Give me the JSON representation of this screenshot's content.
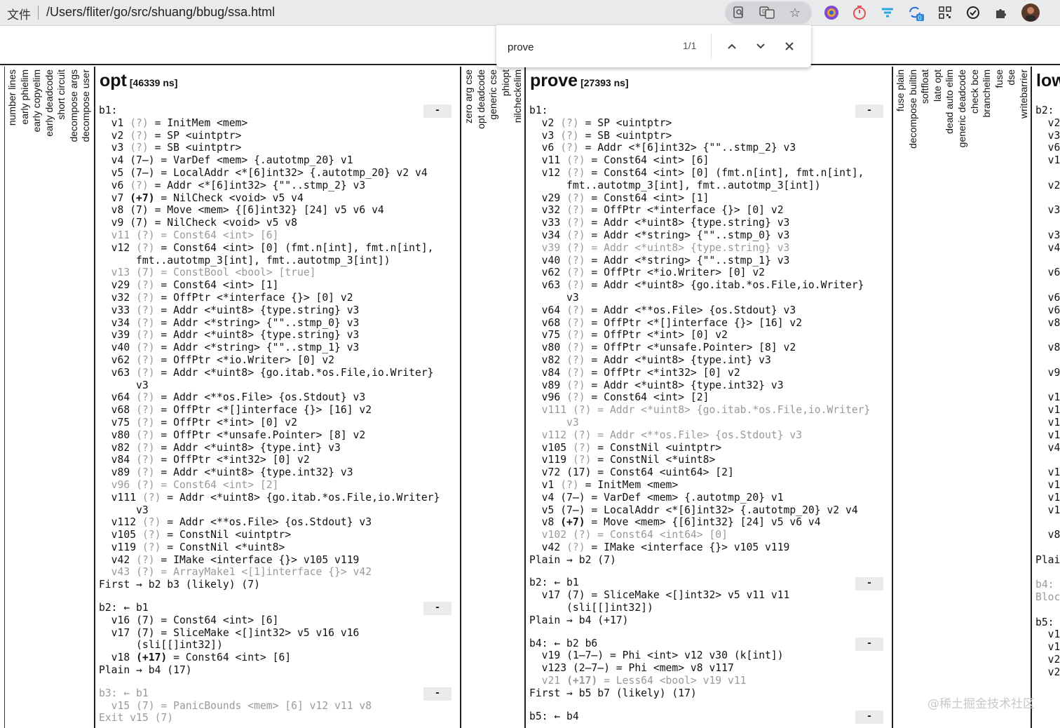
{
  "browser": {
    "page_kind": "文件",
    "url": "/Users/fliter/go/src/shuang/bbug/ssa.html",
    "icons": [
      "page-search-icon",
      "translate-icon",
      "bookmark-star-icon",
      "chrome-extension-icon",
      "timer-extension-icon",
      "filter-extension-icon",
      "sync-extension-icon",
      "qr-code-icon",
      "circle-check-extension-icon",
      "extensions-puzzle-icon",
      "profile-avatar"
    ],
    "sync_badge": "0"
  },
  "find": {
    "query": "prove",
    "count": "1/1"
  },
  "passes_left": [
    "number lines",
    "early phielim",
    "early copyelim",
    "early deadcode",
    "short circuit",
    "decompose args",
    "decompose user"
  ],
  "passes_mid": [
    "zero arg cse",
    "opt deadcode",
    "generic cse",
    "phiopt",
    "nilcheckelim"
  ],
  "passes_right": [
    "fuse plain",
    "decompose builtin",
    "softfloat",
    "late opt",
    "dead auto elim",
    "generic deadcode",
    "check bce",
    "branchelim",
    "fuse",
    "dse",
    "writebarrier"
  ],
  "collapse_label": "-",
  "watermark": "@稀土掘金技术社区",
  "opt": {
    "title": "opt",
    "time": "[46339 ns]",
    "blocks": [
      {
        "header": "b1:",
        "dead": false,
        "lines": [
          {
            "v": "v1",
            "n": "(?)",
            "t": "= InitMem <mem>"
          },
          {
            "v": "v2",
            "n": "(?)",
            "t": "= SP <uintptr>"
          },
          {
            "v": "v3",
            "n": "(?)",
            "t": "= SB <uintptr>"
          },
          {
            "v": "v4",
            "n": "(7̶)",
            "t": "= VarDef <mem> {.autotmp_20} v1"
          },
          {
            "v": "v5",
            "n": "(7̶)",
            "t": "= LocalAddr <*[6]int32> {.autotmp_20} v2 v4"
          },
          {
            "v": "v6",
            "n": "(?)",
            "t": "= Addr <*[6]int32> {\"\"..stmp_2} v3"
          },
          {
            "v": "v7",
            "n": "(+7)",
            "t": "= NilCheck <void> v5 v4"
          },
          {
            "v": "v8",
            "n": "(7)",
            "t": "= Move <mem> {[6]int32} [24] v5 v6 v4"
          },
          {
            "v": "v9",
            "n": "(7)",
            "t": "= NilCheck <void> v5 v8"
          },
          {
            "v": "v11",
            "n": "(?)",
            "t": "= Const64 <int> [6]",
            "dead": true
          },
          {
            "v": "v12",
            "n": "(?)",
            "t": "= Const64 <int> [0] (fmt.n[int], fmt.n[int],"
          },
          {
            "c": "    fmt..autotmp_3[int], fmt..autotmp_3[int])"
          },
          {
            "v": "v13",
            "n": "(7)",
            "t": "= ConstBool <bool> [true]",
            "dead": true
          },
          {
            "v": "v29",
            "n": "(?)",
            "t": "= Const64 <int> [1]"
          },
          {
            "v": "v32",
            "n": "(?)",
            "t": "= OffPtr <*interface {}> [0] v2"
          },
          {
            "v": "v33",
            "n": "(?)",
            "t": "= Addr <*uint8> {type.string} v3"
          },
          {
            "v": "v34",
            "n": "(?)",
            "t": "= Addr <*string> {\"\"..stmp_0} v3"
          },
          {
            "v": "v39",
            "n": "(?)",
            "t": "= Addr <*uint8> {type.string} v3"
          },
          {
            "v": "v40",
            "n": "(?)",
            "t": "= Addr <*string> {\"\"..stmp_1} v3"
          },
          {
            "v": "v62",
            "n": "(?)",
            "t": "= OffPtr <*io.Writer> [0] v2"
          },
          {
            "v": "v63",
            "n": "(?)",
            "t": "= Addr <*uint8> {go.itab.*os.File,io.Writer}"
          },
          {
            "c": "    v3"
          },
          {
            "v": "v64",
            "n": "(?)",
            "t": "= Addr <**os.File> {os.Stdout} v3"
          },
          {
            "v": "v68",
            "n": "(?)",
            "t": "= OffPtr <*[]interface {}> [16] v2"
          },
          {
            "v": "v75",
            "n": "(?)",
            "t": "= OffPtr <*int> [0] v2"
          },
          {
            "v": "v80",
            "n": "(?)",
            "t": "= OffPtr <*unsafe.Pointer> [8] v2"
          },
          {
            "v": "v82",
            "n": "(?)",
            "t": "= Addr <*uint8> {type.int} v3"
          },
          {
            "v": "v84",
            "n": "(?)",
            "t": "= OffPtr <*int32> [0] v2"
          },
          {
            "v": "v89",
            "n": "(?)",
            "t": "= Addr <*uint8> {type.int32} v3"
          },
          {
            "v": "v96",
            "n": "(?)",
            "t": "= Const64 <int> [2]",
            "dead": true
          },
          {
            "v": "v111",
            "n": "(?)",
            "t": "= Addr <*uint8> {go.itab.*os.File,io.Writer}"
          },
          {
            "c": "    v3"
          },
          {
            "v": "v112",
            "n": "(?)",
            "t": "= Addr <**os.File> {os.Stdout} v3"
          },
          {
            "v": "v105",
            "n": "(?)",
            "t": "= ConstNil <uintptr>"
          },
          {
            "v": "v119",
            "n": "(?)",
            "t": "= ConstNil <*uint8>"
          },
          {
            "v": "v42",
            "n": "(?)",
            "t": "= IMake <interface {}> v105 v119"
          },
          {
            "v": "v43",
            "n": "(?)",
            "t": "= ArrayMake1 <[1]interface {}> v42",
            "dead": true
          }
        ],
        "footer": "First → b2 b3 (likely) (7)"
      },
      {
        "header": "b2: ← b1",
        "dead": false,
        "lines": [
          {
            "v": "v16",
            "n": "(7)",
            "t": "= Const64 <int> [6]"
          },
          {
            "v": "v17",
            "n": "(7)",
            "t": "= SliceMake <[]int32> v5 v16 v16"
          },
          {
            "c": "    (sli[[]int32])"
          },
          {
            "v": "v18",
            "n": "(+17)",
            "t": "= Const64 <int> [6]"
          }
        ],
        "footer": "Plain → b4 (17)"
      },
      {
        "header": "b3: ← b1",
        "dead": true,
        "lines": [
          {
            "v": "v15",
            "n": "(7)",
            "t": "= PanicBounds <mem> [6] v12 v11 v8",
            "dead": true
          }
        ],
        "footer": "Exit v15 (7)"
      }
    ]
  },
  "prove": {
    "title": "prove",
    "time": "[27393 ns]",
    "blocks": [
      {
        "header": "b1:",
        "dead": false,
        "lines": [
          {
            "v": "v2",
            "n": "(?)",
            "t": "= SP <uintptr>"
          },
          {
            "v": "v3",
            "n": "(?)",
            "t": "= SB <uintptr>"
          },
          {
            "v": "v6",
            "n": "(?)",
            "t": "= Addr <*[6]int32> {\"\"..stmp_2} v3"
          },
          {
            "v": "v11",
            "n": "(?)",
            "t": "= Const64 <int> [6]"
          },
          {
            "v": "v12",
            "n": "(?)",
            "t": "= Const64 <int> [0] (fmt.n[int], fmt.n[int],"
          },
          {
            "c": "    fmt..autotmp_3[int], fmt..autotmp_3[int])"
          },
          {
            "v": "v29",
            "n": "(?)",
            "t": "= Const64 <int> [1]"
          },
          {
            "v": "v32",
            "n": "(?)",
            "t": "= OffPtr <*interface {}> [0] v2"
          },
          {
            "v": "v33",
            "n": "(?)",
            "t": "= Addr <*uint8> {type.string} v3"
          },
          {
            "v": "v34",
            "n": "(?)",
            "t": "= Addr <*string> {\"\"..stmp_0} v3"
          },
          {
            "v": "v39",
            "n": "(?)",
            "t": "= Addr <*uint8> {type.string} v3",
            "dead": true
          },
          {
            "v": "v40",
            "n": "(?)",
            "t": "= Addr <*string> {\"\"..stmp_1} v3"
          },
          {
            "v": "v62",
            "n": "(?)",
            "t": "= OffPtr <*io.Writer> [0] v2"
          },
          {
            "v": "v63",
            "n": "(?)",
            "t": "= Addr <*uint8> {go.itab.*os.File,io.Writer}"
          },
          {
            "c": "    v3"
          },
          {
            "v": "v64",
            "n": "(?)",
            "t": "= Addr <**os.File> {os.Stdout} v3"
          },
          {
            "v": "v68",
            "n": "(?)",
            "t": "= OffPtr <*[]interface {}> [16] v2"
          },
          {
            "v": "v75",
            "n": "(?)",
            "t": "= OffPtr <*int> [0] v2"
          },
          {
            "v": "v80",
            "n": "(?)",
            "t": "= OffPtr <*unsafe.Pointer> [8] v2"
          },
          {
            "v": "v82",
            "n": "(?)",
            "t": "= Addr <*uint8> {type.int} v3"
          },
          {
            "v": "v84",
            "n": "(?)",
            "t": "= OffPtr <*int32> [0] v2"
          },
          {
            "v": "v89",
            "n": "(?)",
            "t": "= Addr <*uint8> {type.int32} v3"
          },
          {
            "v": "v96",
            "n": "(?)",
            "t": "= Const64 <int> [2]"
          },
          {
            "v": "v111",
            "n": "(?)",
            "t": "= Addr <*uint8> {go.itab.*os.File,io.Writer}",
            "dead": true
          },
          {
            "c": "    v3",
            "dead": true
          },
          {
            "v": "v112",
            "n": "(?)",
            "t": "= Addr <**os.File> {os.Stdout} v3",
            "dead": true
          },
          {
            "v": "v105",
            "n": "(?)",
            "t": "= ConstNil <uintptr>"
          },
          {
            "v": "v119",
            "n": "(?)",
            "t": "= ConstNil <*uint8>"
          },
          {
            "v": "v72",
            "n": "(17)",
            "t": "= Const64 <uint64> [2]"
          },
          {
            "v": "v1",
            "n": "(?)",
            "t": "= InitMem <mem>"
          },
          {
            "v": "v4",
            "n": "(7̶)",
            "t": "= VarDef <mem> {.autotmp_20} v1"
          },
          {
            "v": "v5",
            "n": "(7̶)",
            "t": "= LocalAddr <*[6]int32> {.autotmp_20} v2 v4"
          },
          {
            "v": "v8",
            "n": "(+7)",
            "t": "= Move <mem> {[6]int32} [24] v5 v6 v4"
          },
          {
            "v": "v102",
            "n": "(?)",
            "t": "= Const64 <int64> [0]",
            "dead": true
          },
          {
            "v": "v42",
            "n": "(?)",
            "t": "= IMake <interface {}> v105 v119"
          }
        ],
        "footer": "Plain → b2 (7)"
      },
      {
        "header": "b2: ← b1",
        "dead": false,
        "lines": [
          {
            "v": "v17",
            "n": "(7)",
            "t": "= SliceMake <[]int32> v5 v11 v11"
          },
          {
            "c": "    (sli[[]int32])"
          }
        ],
        "footer": "Plain → b4 (+17)"
      },
      {
        "header": "b4: ← b2 b6",
        "dead": false,
        "lines": [
          {
            "v": "v19",
            "n": "(1̶7̶)",
            "t": "= Phi <int> v12 v30 (k[int])"
          },
          {
            "v": "v123",
            "n": "(2̶7̶)",
            "t": "= Phi <mem> v8 v117"
          },
          {
            "v": "v21",
            "n": "(+17)",
            "t": "= Less64 <bool> v19 v11",
            "dead": true
          }
        ],
        "footer": "First → b5 b7 (likely) (17)"
      },
      {
        "header": "b5: ← b4",
        "dead": false,
        "lines": [],
        "footer": ""
      }
    ]
  },
  "lower": {
    "title": "low",
    "lines": [
      "b2:",
      "v2",
      "v3",
      "v6",
      "v1",
      "",
      "v2",
      "",
      "v3",
      "",
      "v3",
      "v4",
      "",
      "v6",
      "",
      "v6",
      "v6",
      "v8",
      "",
      "v8",
      "",
      "v9",
      "",
      "v1",
      "v1",
      "v1",
      "v1",
      "v4",
      "",
      "v1",
      "v1",
      "v1",
      "v1",
      "",
      "v8",
      "",
      "Plai",
      "",
      "b4:",
      "Bloc",
      "",
      "b5:",
      "v1",
      "v1",
      "v2",
      "v2"
    ]
  }
}
